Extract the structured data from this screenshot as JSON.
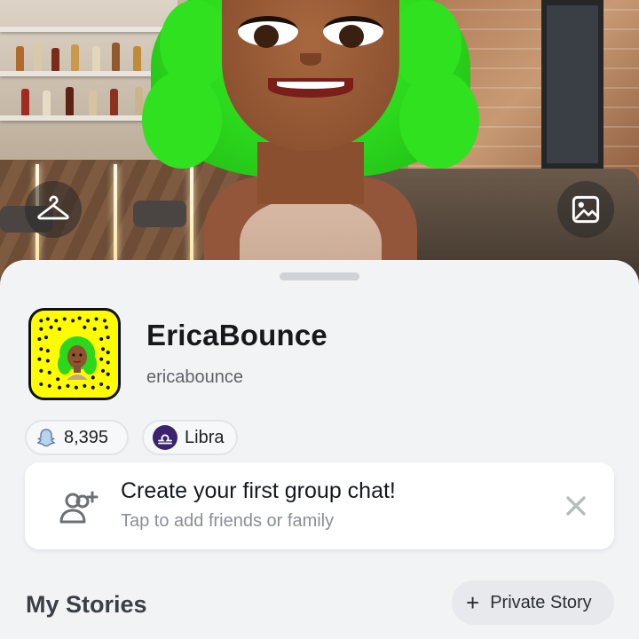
{
  "profile": {
    "display_name": "EricaBounce",
    "username": "ericabounce"
  },
  "chips": {
    "score": "8,395",
    "zodiac": "Libra"
  },
  "group_chat_card": {
    "title": "Create your first group chat!",
    "subtitle": "Tap to add friends or family"
  },
  "stories": {
    "section_title": "My Stories",
    "private_story_label": "Private Story"
  },
  "icons": {
    "outfit": "hanger-icon",
    "background": "image-icon",
    "score": "ghost-icon",
    "zodiac": "libra-icon",
    "add_friends": "add-friend-icon",
    "dismiss": "close-icon",
    "add": "plus-icon"
  },
  "colors": {
    "snapcode_yellow": "#fffc00",
    "hair_green": "#2bd81c",
    "libra_purple": "#3a2470"
  }
}
